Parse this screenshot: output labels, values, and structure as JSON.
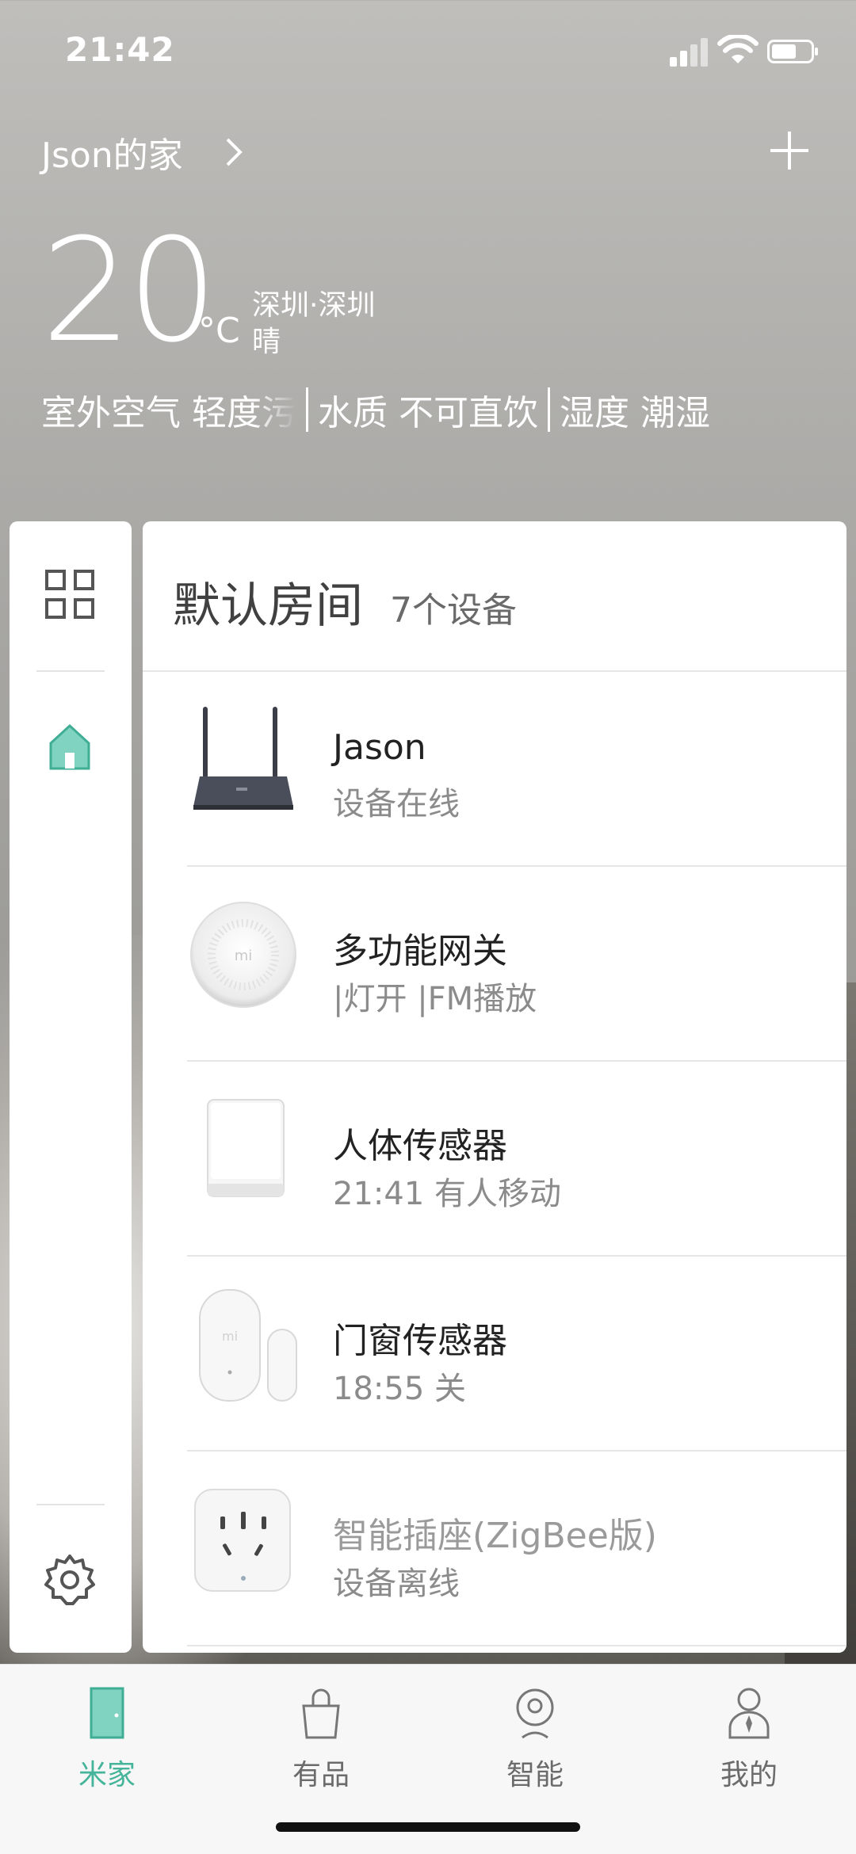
{
  "status_bar": {
    "time": "21:42"
  },
  "header": {
    "home_name": "Json的家",
    "chevron_icon": "chevron-right-icon",
    "add_icon": "plus-icon"
  },
  "weather": {
    "temperature": "20",
    "unit": "°C",
    "location": "深圳·深圳",
    "condition": "晴",
    "air_label": "室外空气",
    "air_value": "轻度污",
    "water_label": "水质",
    "water_value": "不可直饮",
    "humidity_label": "湿度",
    "humidity_value": "潮湿"
  },
  "sidebar": {
    "grid_icon": "grid-icon",
    "home_icon": "home-icon",
    "settings_icon": "gear-icon"
  },
  "room": {
    "title": "默认房间",
    "count": "7个设备"
  },
  "devices": [
    {
      "name": "Jason",
      "status": "设备在线",
      "icon": "router-icon"
    },
    {
      "name": "多功能网关",
      "status": "|灯开 |FM播放",
      "icon": "gateway-icon"
    },
    {
      "name": "人体传感器",
      "status": "21:41 有人移动",
      "icon": "motion-sensor-icon"
    },
    {
      "name": "门窗传感器",
      "status": "18:55 关",
      "icon": "door-sensor-icon"
    },
    {
      "name": "智能插座(ZigBee版)",
      "status": "设备离线",
      "icon": "smart-plug-icon"
    }
  ],
  "tabs": [
    {
      "label": "米家",
      "icon": "door-icon",
      "active": true
    },
    {
      "label": "有品",
      "icon": "shopping-bag-icon",
      "active": false
    },
    {
      "label": "智能",
      "icon": "camera-icon",
      "active": false
    },
    {
      "label": "我的",
      "icon": "profile-icon",
      "active": false
    }
  ],
  "colors": {
    "accent": "#45b49a"
  }
}
